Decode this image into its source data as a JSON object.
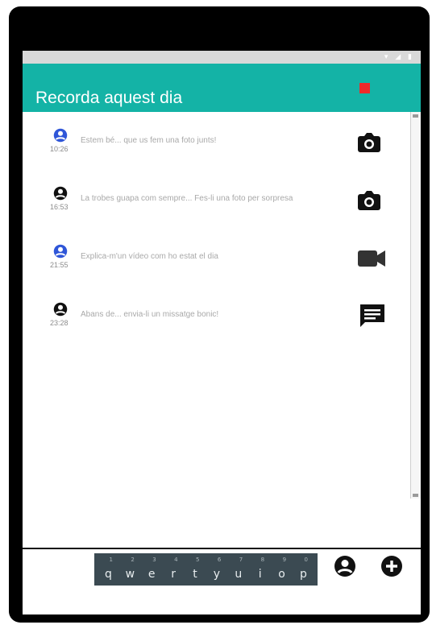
{
  "app": {
    "title": "Recorda aquest dia"
  },
  "status_bar": {
    "icons": "▾ ◢ ▮"
  },
  "colors": {
    "app_bar": "#14b3a6",
    "record": "#ee2a2a",
    "avatar_blue": "#2f56d8",
    "avatar_black": "#111111"
  },
  "entries": [
    {
      "avatar": "person-icon",
      "avatar_color": "blue",
      "time": "10:26",
      "message": "Estem bé... que us fem una foto junts!",
      "action": "camera-icon"
    },
    {
      "avatar": "person-icon",
      "avatar_color": "black",
      "time": "16:53",
      "message": "La trobes guapa com sempre... Fes-li una foto per sorpresa",
      "action": "camera-icon"
    },
    {
      "avatar": "person-icon",
      "avatar_color": "blue",
      "time": "21:55",
      "message": "Explica-m'un vídeo com ho estat el dia",
      "action": "videocam-icon"
    },
    {
      "avatar": "person-icon",
      "avatar_color": "black",
      "time": "23:28",
      "message": "Abans de... envia-li un missatge bonic!",
      "action": "message-icon"
    }
  ],
  "keyboard": {
    "keys": [
      "q",
      "w",
      "e",
      "r",
      "t",
      "y",
      "u",
      "i",
      "o",
      "p"
    ],
    "hints": [
      "1",
      "2",
      "3",
      "4",
      "5",
      "6",
      "7",
      "8",
      "9",
      "0"
    ]
  },
  "bottom_icons": [
    "account-icon",
    "add-circle-icon"
  ]
}
